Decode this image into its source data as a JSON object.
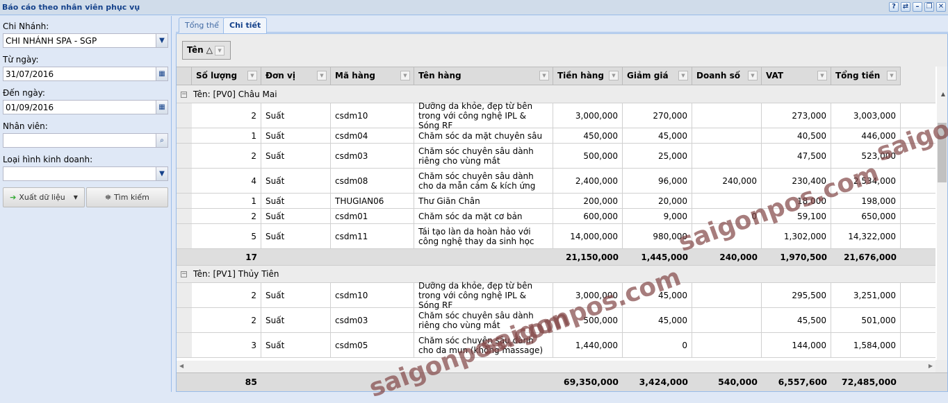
{
  "window": {
    "title": "Báo cáo theo nhân viên phục vụ",
    "tools": [
      "?",
      "⇄",
      "–",
      "❐",
      "✕"
    ]
  },
  "filters": {
    "branch_label": "Chi Nhánh:",
    "branch_value": "CHI NHÁNH SPA - SGP",
    "from_label": "Từ ngày:",
    "from_value": "31/07/2016",
    "to_label": "Đến ngày:",
    "to_value": "01/09/2016",
    "staff_label": "Nhân viên:",
    "staff_value": "",
    "biz_label": "Loại hình kinh doanh:",
    "biz_value": "",
    "export_label": "Xuất dữ liệu",
    "search_label": "Tìm kiếm"
  },
  "tabs": [
    {
      "label": "Tổng thể"
    },
    {
      "label": "Chi tiết"
    }
  ],
  "groupby": {
    "label": "Tên △"
  },
  "columns": [
    "Số lượng",
    "Đơn vị",
    "Mã hàng",
    "Tên hàng",
    "Tiền hàng",
    "Giảm giá",
    "Doanh số",
    "VAT",
    "Tổng tiền"
  ],
  "groups": [
    {
      "title": "Tên: [PV0] Châu Mai",
      "rows": [
        [
          "2",
          "Suất",
          "csdm10",
          "Dưỡng da khỏe, đẹp từ bên trong với công nghệ IPL & Sóng RF",
          "3,000,000",
          "270,000",
          "",
          "273,000",
          "3,003,000"
        ],
        [
          "1",
          "Suất",
          "csdm04",
          "Chăm sóc da mặt chuyên sâu",
          "450,000",
          "45,000",
          "",
          "40,500",
          "446,000"
        ],
        [
          "2",
          "Suất",
          "csdm03",
          "Chăm sóc chuyên sâu dành riêng cho vùng mắt",
          "500,000",
          "25,000",
          "",
          "47,500",
          "523,000"
        ],
        [
          "4",
          "Suất",
          "csdm08",
          "Chăm sóc chuyên sâu dành cho da mẫn cảm & kích ứng",
          "2,400,000",
          "96,000",
          "240,000",
          "230,400",
          "2,534,000"
        ],
        [
          "1",
          "Suất",
          "THUGIAN06",
          " Thư Giãn Chân",
          "200,000",
          "20,000",
          "",
          "18,000",
          "198,000"
        ],
        [
          "2",
          "Suất",
          "csdm01",
          "Chăm sóc da mặt cơ bản",
          "600,000",
          "9,000",
          "0",
          "59,100",
          "650,000"
        ],
        [
          "5",
          "Suất",
          "csdm11",
          "Tái tạo làn da hoàn hảo với công nghệ thay da sinh học",
          "14,000,000",
          "980,000",
          "",
          "1,302,000",
          "14,322,000"
        ]
      ],
      "summary": [
        "17",
        "",
        "",
        "",
        "21,150,000",
        "1,445,000",
        "240,000",
        "1,970,500",
        "21,676,000"
      ]
    },
    {
      "title": "Tên: [PV1] Thủy Tiên",
      "rows": [
        [
          "2",
          "Suất",
          "csdm10",
          "Dưỡng da khỏe, đẹp từ bên trong với công nghệ IPL & Sóng RF",
          "3,000,000",
          "45,000",
          "",
          "295,500",
          "3,251,000"
        ],
        [
          "2",
          "Suất",
          "csdm03",
          "Chăm sóc chuyên sâu dành riêng cho vùng mắt",
          "500,000",
          "45,000",
          "",
          "45,500",
          "501,000"
        ],
        [
          "3",
          "Suất",
          "csdm05",
          "Chăm sóc chuyên sâu dành cho da mụn (không massage)",
          "1,440,000",
          "0",
          "",
          "144,000",
          "1,584,000"
        ]
      ],
      "summary": null
    }
  ],
  "footer": [
    "85",
    "",
    "",
    "",
    "69,350,000",
    "3,424,000",
    "540,000",
    "6,557,600",
    "72,485,000"
  ],
  "watermark": "saigonpos.com"
}
